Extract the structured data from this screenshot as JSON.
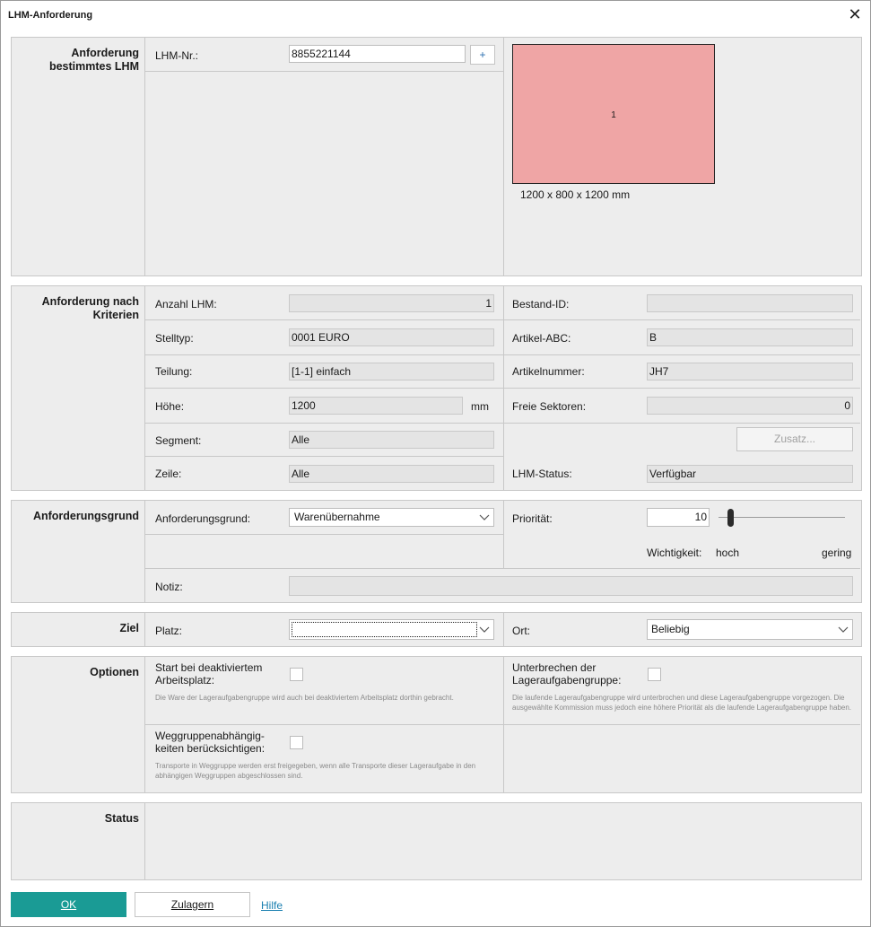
{
  "window": {
    "title": "LHM-Anforderung"
  },
  "sec1": {
    "heading": "Anforderung bestimmtes LHM",
    "lhm_nr_label": "LHM-Nr.:",
    "lhm_nr_value": "8855221144",
    "plus": "+",
    "preview_number": "1",
    "preview_dims": "1200 x 800 x 1200 mm",
    "preview_color": "#efa5a5"
  },
  "sec2": {
    "heading": "Anforderung nach Kriterien",
    "anzahl_label": "Anzahl LHM:",
    "anzahl_value": "1",
    "stelltyp_label": "Stelltyp:",
    "stelltyp_value": "0001  EURO",
    "teilung_label": "Teilung:",
    "teilung_value": "[1-1] einfach",
    "hoehe_label": "Höhe:",
    "hoehe_value": "1200",
    "hoehe_unit": "mm",
    "segment_label": "Segment:",
    "segment_value": "Alle",
    "zeile_label": "Zeile:",
    "zeile_value": "Alle",
    "bestand_label": "Bestand-ID:",
    "bestand_value": "",
    "artikel_abc_label": "Artikel-ABC:",
    "artikel_abc_value": "B",
    "artikelnummer_label": "Artikelnummer:",
    "artikelnummer_value": "JH7",
    "sektoren_label": "Freie Sektoren:",
    "sektoren_value": "0",
    "zusatz_button": "Zusatz...",
    "status_label": "LHM-Status:",
    "status_value": "Verfügbar"
  },
  "sec3": {
    "heading": "Anforderungsgrund",
    "grund_label": "Anforderungsgrund:",
    "grund_value": "Warenübernahme",
    "prio_label": "Priorität:",
    "prio_value": "10",
    "slider_fraction": 0.1,
    "wichtigkeit_label": "Wichtigkeit:",
    "hoch": "hoch",
    "gering": "gering",
    "notiz_label": "Notiz:",
    "notiz_value": ""
  },
  "sec4": {
    "heading": "Ziel",
    "platz_label": "Platz:",
    "platz_value": "",
    "ort_label": "Ort:",
    "ort_value": "Beliebig"
  },
  "sec5": {
    "heading": "Optionen",
    "opt1_label": "Start bei deaktiviertem Arbeitsplatz:",
    "opt1_desc": "Die Ware der Lageraufgabengruppe wird auch bei deaktiviertem Arbeitsplatz dorthin gebracht.",
    "opt2_label": "Unterbrechen der Lageraufgabengruppe:",
    "opt2_desc": "Die laufende Lageraufgabengruppe wird unterbrochen und diese Lageraufgabengruppe vorgezogen. Die ausgewählte Kommission muss jedoch eine höhere Priorität als die laufende Lageraufgabengruppe haben.",
    "opt3_label": "Weggruppenabhängig-keiten berücksichtigen:",
    "opt3_desc": "Transporte in Weggruppe werden erst freigegeben, wenn alle Transporte dieser Lageraufgabe in den abhängigen Weggruppen abgeschlossen sind."
  },
  "sec6": {
    "heading": "Status"
  },
  "footer": {
    "ok": "OK",
    "zulagern": "Zulagern",
    "hilfe": "Hilfe",
    "ok_color": "#1a9b95"
  }
}
